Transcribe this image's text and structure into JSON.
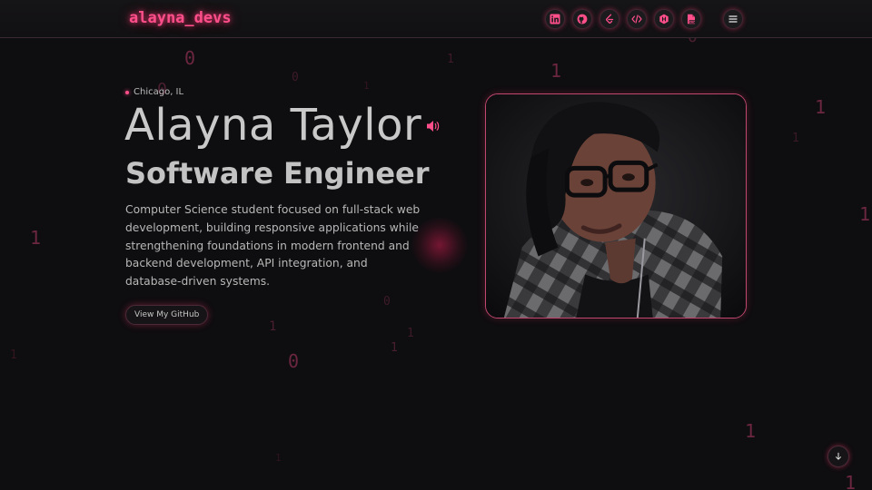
{
  "header": {
    "logo": "alayna_devs",
    "icons": [
      "linkedin-icon",
      "github-icon",
      "leetcode-icon",
      "code-icon",
      "hackerrank-icon",
      "resume-pdf-icon"
    ],
    "menu_icon": "hamburger-menu-icon"
  },
  "hero": {
    "location": "Chicago, IL",
    "name": "Alayna Taylor",
    "title": "Software Engineer",
    "bio": "Computer Science student focused on full-stack web development, building responsive applications while strengthening foundations in modern frontend and backend development, API integration, and database-driven systems.",
    "github_button": "View My GitHub"
  },
  "background_bits": [
    "0",
    "0",
    "1",
    "0",
    "1",
    "1",
    "1",
    "1",
    "0",
    "1",
    "1",
    "0",
    "1",
    "1",
    "0",
    "1",
    "1",
    "1",
    "0",
    "1",
    "1",
    "1",
    "1"
  ],
  "colors": {
    "accent": "#ff4f8b",
    "background": "#0e0d0f",
    "frame_border": "#c1476f"
  }
}
